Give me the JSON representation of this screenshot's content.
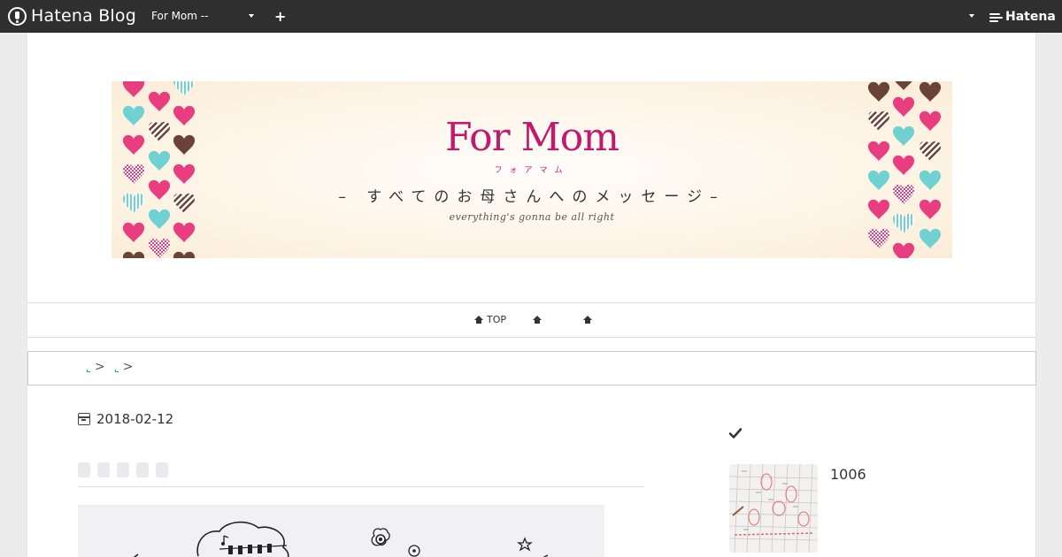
{
  "topbar": {
    "logo_text": "Hatena Blog",
    "blog_select_value": "For Mom --",
    "add_label": "+",
    "hatena_text": "Hatena"
  },
  "banner": {
    "title": "For Mom",
    "title_kana": "フォアマム",
    "subtitle": "– すべてのお母さんへのメッセージ–",
    "tagline": "everything's gonna be all right",
    "colors": {
      "pink": "#e83e7f",
      "aqua": "#6fd1d1",
      "brown": "#6b4237",
      "title": "#c2186d"
    }
  },
  "nav": {
    "items": [
      {
        "label": "TOP",
        "icon": "home-icon"
      },
      {
        "label": "",
        "icon": "home-icon"
      },
      {
        "label": "",
        "icon": "home-icon"
      }
    ]
  },
  "breadcrumb": {
    "separator": ">"
  },
  "article": {
    "date": "2018-02-12"
  },
  "sidebar": {
    "count": "1006"
  }
}
